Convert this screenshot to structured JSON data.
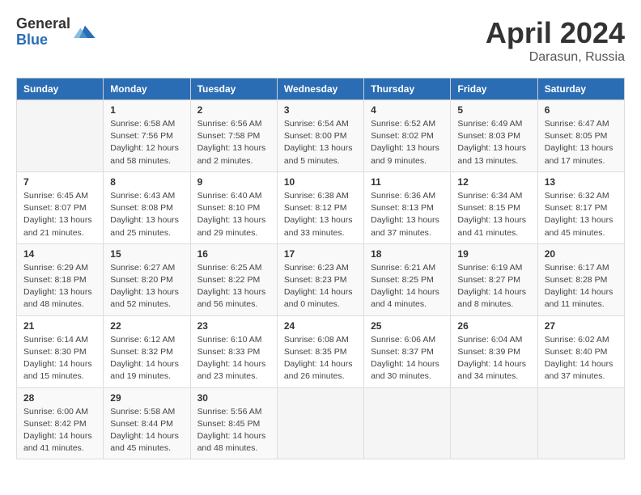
{
  "header": {
    "logo_general": "General",
    "logo_blue": "Blue",
    "title": "April 2024",
    "location": "Darasun, Russia"
  },
  "weekdays": [
    "Sunday",
    "Monday",
    "Tuesday",
    "Wednesday",
    "Thursday",
    "Friday",
    "Saturday"
  ],
  "weeks": [
    [
      {
        "day": "",
        "sunrise": "",
        "sunset": "",
        "daylight": ""
      },
      {
        "day": "1",
        "sunrise": "Sunrise: 6:58 AM",
        "sunset": "Sunset: 7:56 PM",
        "daylight": "Daylight: 12 hours and 58 minutes."
      },
      {
        "day": "2",
        "sunrise": "Sunrise: 6:56 AM",
        "sunset": "Sunset: 7:58 PM",
        "daylight": "Daylight: 13 hours and 2 minutes."
      },
      {
        "day": "3",
        "sunrise": "Sunrise: 6:54 AM",
        "sunset": "Sunset: 8:00 PM",
        "daylight": "Daylight: 13 hours and 5 minutes."
      },
      {
        "day": "4",
        "sunrise": "Sunrise: 6:52 AM",
        "sunset": "Sunset: 8:02 PM",
        "daylight": "Daylight: 13 hours and 9 minutes."
      },
      {
        "day": "5",
        "sunrise": "Sunrise: 6:49 AM",
        "sunset": "Sunset: 8:03 PM",
        "daylight": "Daylight: 13 hours and 13 minutes."
      },
      {
        "day": "6",
        "sunrise": "Sunrise: 6:47 AM",
        "sunset": "Sunset: 8:05 PM",
        "daylight": "Daylight: 13 hours and 17 minutes."
      }
    ],
    [
      {
        "day": "7",
        "sunrise": "Sunrise: 6:45 AM",
        "sunset": "Sunset: 8:07 PM",
        "daylight": "Daylight: 13 hours and 21 minutes."
      },
      {
        "day": "8",
        "sunrise": "Sunrise: 6:43 AM",
        "sunset": "Sunset: 8:08 PM",
        "daylight": "Daylight: 13 hours and 25 minutes."
      },
      {
        "day": "9",
        "sunrise": "Sunrise: 6:40 AM",
        "sunset": "Sunset: 8:10 PM",
        "daylight": "Daylight: 13 hours and 29 minutes."
      },
      {
        "day": "10",
        "sunrise": "Sunrise: 6:38 AM",
        "sunset": "Sunset: 8:12 PM",
        "daylight": "Daylight: 13 hours and 33 minutes."
      },
      {
        "day": "11",
        "sunrise": "Sunrise: 6:36 AM",
        "sunset": "Sunset: 8:13 PM",
        "daylight": "Daylight: 13 hours and 37 minutes."
      },
      {
        "day": "12",
        "sunrise": "Sunrise: 6:34 AM",
        "sunset": "Sunset: 8:15 PM",
        "daylight": "Daylight: 13 hours and 41 minutes."
      },
      {
        "day": "13",
        "sunrise": "Sunrise: 6:32 AM",
        "sunset": "Sunset: 8:17 PM",
        "daylight": "Daylight: 13 hours and 45 minutes."
      }
    ],
    [
      {
        "day": "14",
        "sunrise": "Sunrise: 6:29 AM",
        "sunset": "Sunset: 8:18 PM",
        "daylight": "Daylight: 13 hours and 48 minutes."
      },
      {
        "day": "15",
        "sunrise": "Sunrise: 6:27 AM",
        "sunset": "Sunset: 8:20 PM",
        "daylight": "Daylight: 13 hours and 52 minutes."
      },
      {
        "day": "16",
        "sunrise": "Sunrise: 6:25 AM",
        "sunset": "Sunset: 8:22 PM",
        "daylight": "Daylight: 13 hours and 56 minutes."
      },
      {
        "day": "17",
        "sunrise": "Sunrise: 6:23 AM",
        "sunset": "Sunset: 8:23 PM",
        "daylight": "Daylight: 14 hours and 0 minutes."
      },
      {
        "day": "18",
        "sunrise": "Sunrise: 6:21 AM",
        "sunset": "Sunset: 8:25 PM",
        "daylight": "Daylight: 14 hours and 4 minutes."
      },
      {
        "day": "19",
        "sunrise": "Sunrise: 6:19 AM",
        "sunset": "Sunset: 8:27 PM",
        "daylight": "Daylight: 14 hours and 8 minutes."
      },
      {
        "day": "20",
        "sunrise": "Sunrise: 6:17 AM",
        "sunset": "Sunset: 8:28 PM",
        "daylight": "Daylight: 14 hours and 11 minutes."
      }
    ],
    [
      {
        "day": "21",
        "sunrise": "Sunrise: 6:14 AM",
        "sunset": "Sunset: 8:30 PM",
        "daylight": "Daylight: 14 hours and 15 minutes."
      },
      {
        "day": "22",
        "sunrise": "Sunrise: 6:12 AM",
        "sunset": "Sunset: 8:32 PM",
        "daylight": "Daylight: 14 hours and 19 minutes."
      },
      {
        "day": "23",
        "sunrise": "Sunrise: 6:10 AM",
        "sunset": "Sunset: 8:33 PM",
        "daylight": "Daylight: 14 hours and 23 minutes."
      },
      {
        "day": "24",
        "sunrise": "Sunrise: 6:08 AM",
        "sunset": "Sunset: 8:35 PM",
        "daylight": "Daylight: 14 hours and 26 minutes."
      },
      {
        "day": "25",
        "sunrise": "Sunrise: 6:06 AM",
        "sunset": "Sunset: 8:37 PM",
        "daylight": "Daylight: 14 hours and 30 minutes."
      },
      {
        "day": "26",
        "sunrise": "Sunrise: 6:04 AM",
        "sunset": "Sunset: 8:39 PM",
        "daylight": "Daylight: 14 hours and 34 minutes."
      },
      {
        "day": "27",
        "sunrise": "Sunrise: 6:02 AM",
        "sunset": "Sunset: 8:40 PM",
        "daylight": "Daylight: 14 hours and 37 minutes."
      }
    ],
    [
      {
        "day": "28",
        "sunrise": "Sunrise: 6:00 AM",
        "sunset": "Sunset: 8:42 PM",
        "daylight": "Daylight: 14 hours and 41 minutes."
      },
      {
        "day": "29",
        "sunrise": "Sunrise: 5:58 AM",
        "sunset": "Sunset: 8:44 PM",
        "daylight": "Daylight: 14 hours and 45 minutes."
      },
      {
        "day": "30",
        "sunrise": "Sunrise: 5:56 AM",
        "sunset": "Sunset: 8:45 PM",
        "daylight": "Daylight: 14 hours and 48 minutes."
      },
      {
        "day": "",
        "sunrise": "",
        "sunset": "",
        "daylight": ""
      },
      {
        "day": "",
        "sunrise": "",
        "sunset": "",
        "daylight": ""
      },
      {
        "day": "",
        "sunrise": "",
        "sunset": "",
        "daylight": ""
      },
      {
        "day": "",
        "sunrise": "",
        "sunset": "",
        "daylight": ""
      }
    ]
  ]
}
